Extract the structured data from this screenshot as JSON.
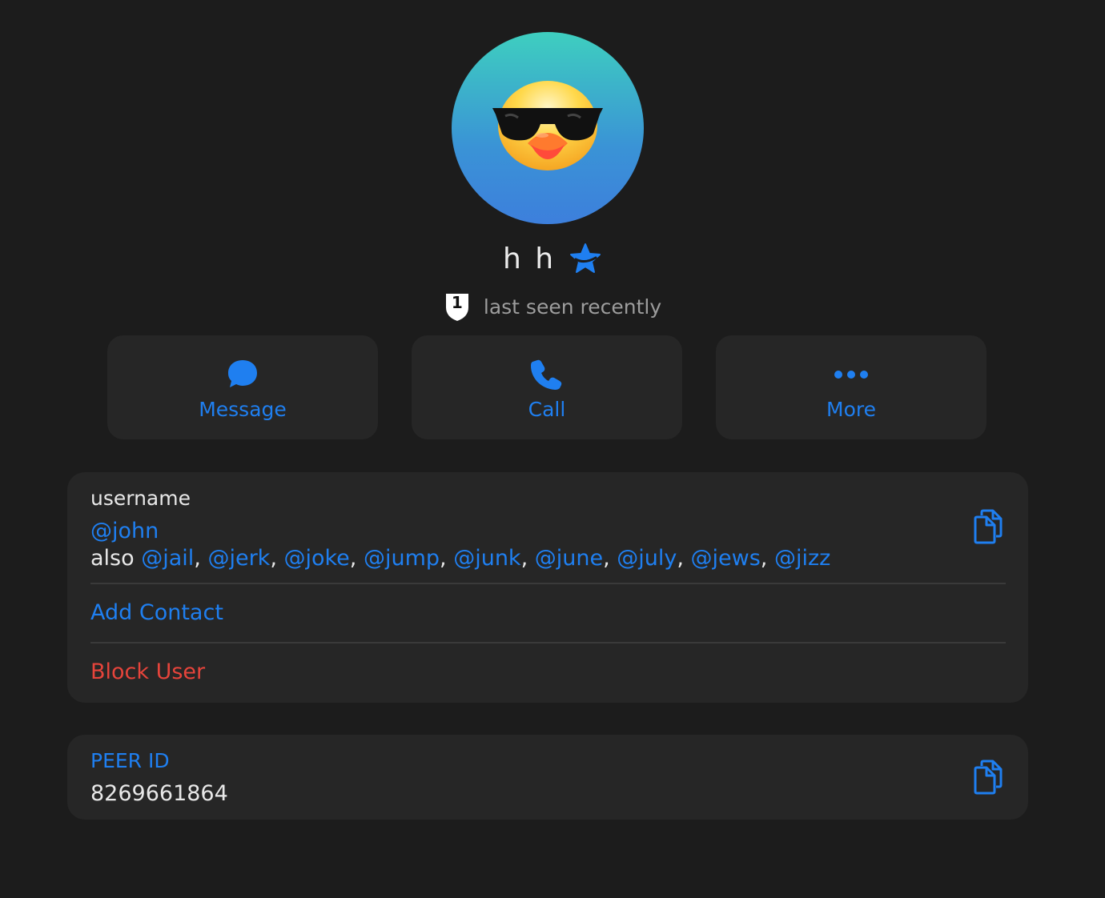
{
  "profile": {
    "name": "h h",
    "status": "last seen recently",
    "shield_badge": "1",
    "avatar_emoji": "sunglasses-duck-face",
    "verified_icon": "star-icon"
  },
  "actions": [
    {
      "label": "Message",
      "icon": "chat-bubble-icon"
    },
    {
      "label": "Call",
      "icon": "phone-icon"
    },
    {
      "label": "More",
      "icon": "ellipsis-icon"
    }
  ],
  "username_card": {
    "label": "username",
    "primary": "@john",
    "also_prefix": "also ",
    "aliases": [
      "@jail",
      "@jerk",
      "@joke",
      "@jump",
      "@junk",
      "@june",
      "@july",
      "@jews",
      "@jizz"
    ],
    "separator": ", ",
    "add_contact": "Add Contact",
    "block_user": "Block User"
  },
  "peer_card": {
    "label": "PEER ID",
    "value": "8269661864"
  },
  "colors": {
    "background": "#1c1c1c",
    "card": "#262626",
    "accent": "#1f7ff0",
    "destructive": "#e5443b",
    "text": "#e8e8e8",
    "muted": "#9d9d9d"
  }
}
